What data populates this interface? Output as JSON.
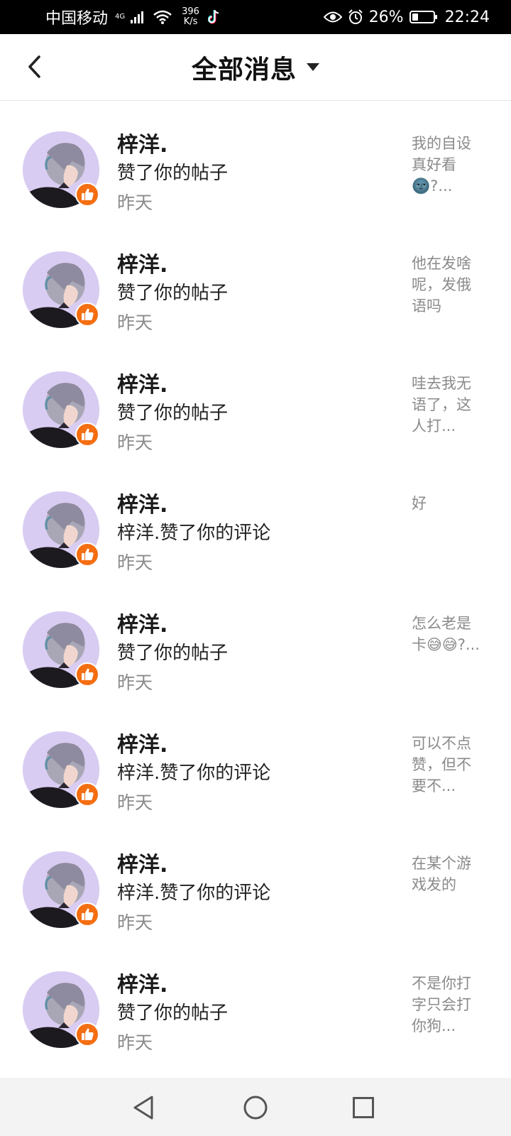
{
  "status_bar": {
    "carrier": "中国移动",
    "network": "4G",
    "speed_value": "396",
    "speed_unit": "K/s",
    "battery": "26%",
    "time": "22:24"
  },
  "header": {
    "title": "全部消息"
  },
  "messages": [
    {
      "name": "梓洋.",
      "action": "赞了你的帖子",
      "time": "昨天",
      "preview": "我的自设真好看🌚?..."
    },
    {
      "name": "梓洋.",
      "action": "赞了你的帖子",
      "time": "昨天",
      "preview": "他在发啥呢，发俄语吗"
    },
    {
      "name": "梓洋.",
      "action": "赞了你的帖子",
      "time": "昨天",
      "preview": "哇去我无语了，这人打..."
    },
    {
      "name": "梓洋.",
      "action": "梓洋.赞了你的评论",
      "time": "昨天",
      "preview": "好"
    },
    {
      "name": "梓洋.",
      "action": "赞了你的帖子",
      "time": "昨天",
      "preview": "怎么老是卡😅😅?..."
    },
    {
      "name": "梓洋.",
      "action": "梓洋.赞了你的评论",
      "time": "昨天",
      "preview": "可以不点赞，但不要不..."
    },
    {
      "name": "梓洋.",
      "action": "梓洋.赞了你的评论",
      "time": "昨天",
      "preview": "在某个游戏发的"
    },
    {
      "name": "梓洋.",
      "action": "赞了你的帖子",
      "time": "昨天",
      "preview": "不是你打字只会打你狗..."
    }
  ],
  "icons": {
    "back": "chevron-left-icon",
    "dropdown": "caret-down-icon",
    "like": "thumbs-up-icon",
    "nav_back": "triangle-back-icon",
    "nav_home": "circle-home-icon",
    "nav_recent": "square-recent-icon"
  },
  "colors": {
    "accent": "#f46e12",
    "avatar_bg": "#d9ccf2",
    "secondary_text": "#8a8a8a"
  }
}
